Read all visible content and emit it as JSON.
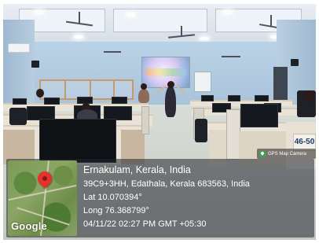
{
  "photo": {
    "seat_label": "46-50",
    "camera_badge": "GPS Map Camera",
    "icons": {
      "badge": "gps-map-camera-icon",
      "pin": "map-pin-icon"
    }
  },
  "overlay": {
    "map_logo": "Google",
    "location_title": "Ernakulam, Kerala, India",
    "address": "39C9+3HH, Edathala, Kerala 683563, India",
    "latitude": "Lat 10.070394°",
    "longitude": "Long 76.368799°",
    "timestamp": "04/11/22 02:27 PM GMT +05:30"
  },
  "colors": {
    "overlay_bg": "#23262d",
    "pin": "#e2342b",
    "badge_icon": "#3fa34d"
  }
}
